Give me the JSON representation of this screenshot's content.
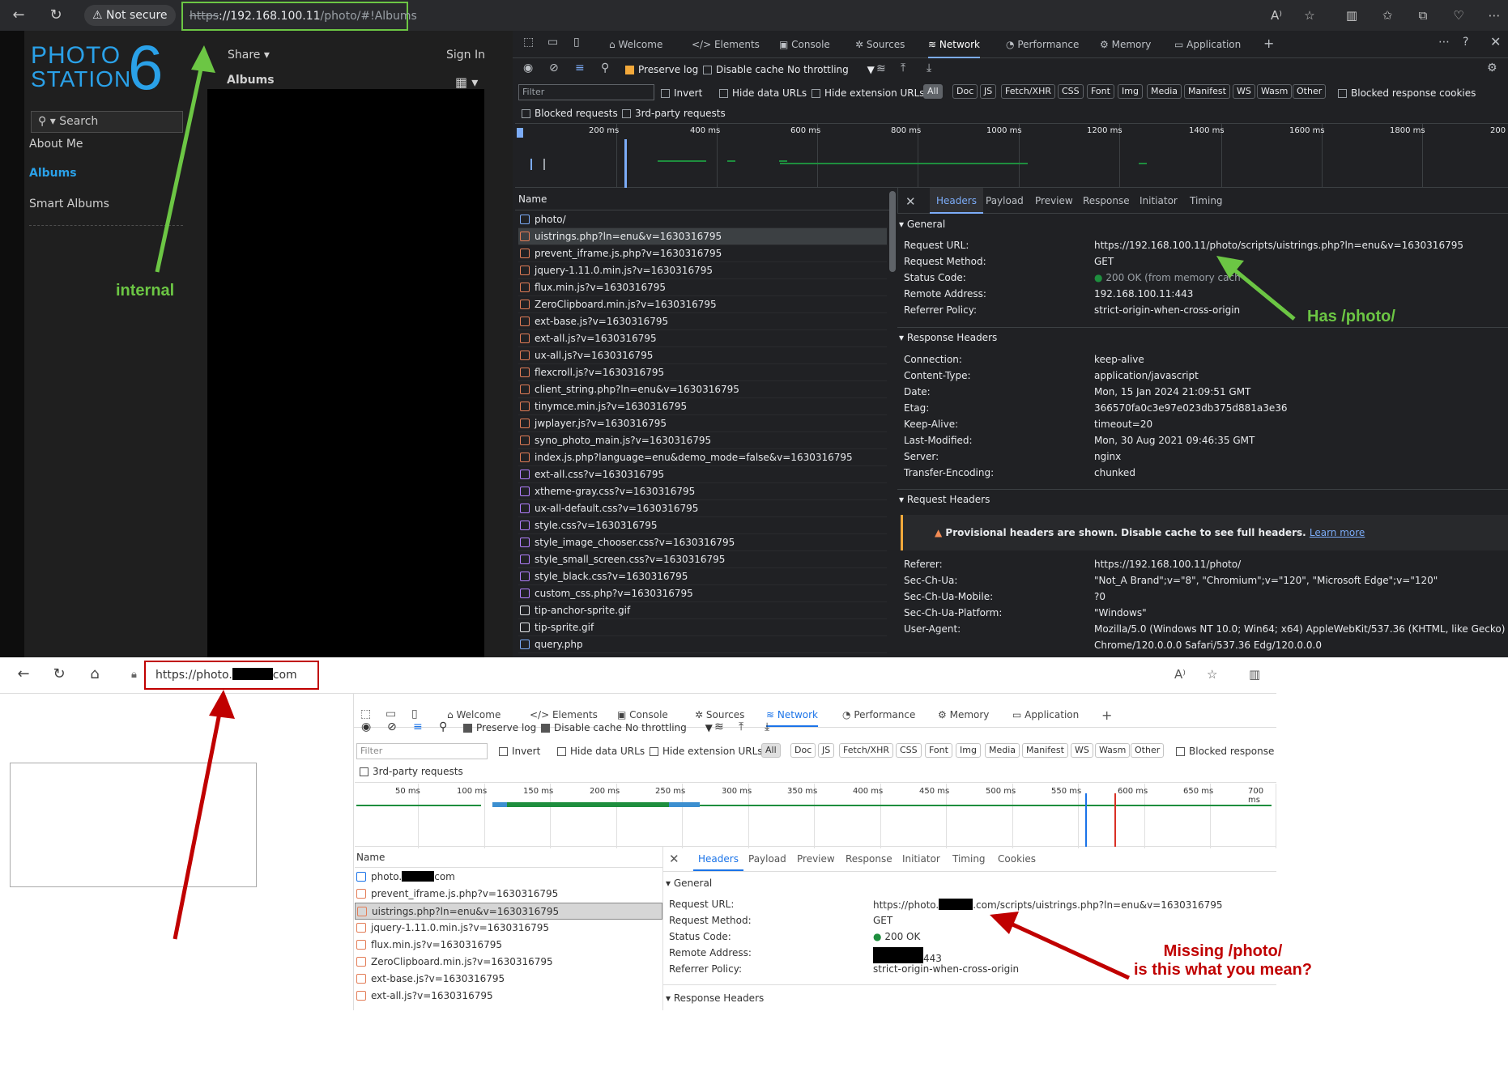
{
  "top": {
    "not_secure": "Not secure",
    "url_https": "https",
    "url_rest": "://192.168.100.11",
    "url_path": "/photo/#!Albums",
    "photostation": {
      "logo_line1": "PHOTO",
      "logo_line2": "STATION",
      "logo_num": "6",
      "share": "Share ▾",
      "sign_in": "Sign In",
      "albums_header": "Albums",
      "search": "Search",
      "nav": [
        "About Me",
        "Albums",
        "Smart Albums"
      ]
    },
    "devtools": {
      "tabs": [
        "Welcome",
        "Elements",
        "Console",
        "Sources",
        "Network",
        "Performance",
        "Memory",
        "Application"
      ],
      "preserve_log": "Preserve log",
      "disable_cache": "Disable cache",
      "throttling": "No throttling",
      "filter_placeholder": "Filter",
      "invert": "Invert",
      "hide_data_urls": "Hide data URLs",
      "hide_ext_urls": "Hide extension URLs",
      "chips": [
        "All",
        "Doc",
        "JS",
        "Fetch/XHR",
        "CSS",
        "Font",
        "Img",
        "Media",
        "Manifest",
        "WS",
        "Wasm",
        "Other"
      ],
      "blocked_cookies": "Blocked response cookies",
      "blocked_requests": "Blocked requests",
      "third_party": "3rd-party requests",
      "ticks": [
        "200 ms",
        "400 ms",
        "600 ms",
        "800 ms",
        "1000 ms",
        "1200 ms",
        "1400 ms",
        "1600 ms",
        "1800 ms",
        "200"
      ],
      "name_header": "Name",
      "requests": [
        "photo/",
        "uistrings.php?ln=enu&v=1630316795",
        "prevent_iframe.js.php?v=1630316795",
        "jquery-1.11.0.min.js?v=1630316795",
        "flux.min.js?v=1630316795",
        "ZeroClipboard.min.js?v=1630316795",
        "ext-base.js?v=1630316795",
        "ext-all.js?v=1630316795",
        "ux-all.js?v=1630316795",
        "flexcroll.js?v=1630316795",
        "client_string.php?ln=enu&v=1630316795",
        "tinymce.min.js?v=1630316795",
        "jwplayer.js?v=1630316795",
        "syno_photo_main.js?v=1630316795",
        "index.js.php?language=enu&demo_mode=false&v=1630316795",
        "ext-all.css?v=1630316795",
        "xtheme-gray.css?v=1630316795",
        "ux-all-default.css?v=1630316795",
        "style.css?v=1630316795",
        "style_image_chooser.css?v=1630316795",
        "style_small_screen.css?v=1630316795",
        "style_black.css?v=1630316795",
        "custom_css.php?v=1630316795",
        "tip-anchor-sprite.gif",
        "tip-sprite.gif",
        "query.php"
      ],
      "detail_tabs": [
        "Headers",
        "Payload",
        "Preview",
        "Response",
        "Initiator",
        "Timing"
      ],
      "general_title": "General",
      "general": [
        [
          "Request URL:",
          "https://192.168.100.11/photo/scripts/uistrings.php?ln=enu&v=1630316795"
        ],
        [
          "Request Method:",
          "GET"
        ],
        [
          "Status Code:",
          "200 OK (from memory cach"
        ],
        [
          "Remote Address:",
          "192.168.100.11:443"
        ],
        [
          "Referrer Policy:",
          "strict-origin-when-cross-origin"
        ]
      ],
      "response_title": "Response Headers",
      "response": [
        [
          "Connection:",
          "keep-alive"
        ],
        [
          "Content-Type:",
          "application/javascript"
        ],
        [
          "Date:",
          "Mon, 15 Jan 2024 21:09:51 GMT"
        ],
        [
          "Etag:",
          "366570fa0c3e97e023db375d881a3e36"
        ],
        [
          "Keep-Alive:",
          "timeout=20"
        ],
        [
          "Last-Modified:",
          "Mon, 30 Aug 2021 09:46:35 GMT"
        ],
        [
          "Server:",
          "nginx"
        ],
        [
          "Transfer-Encoding:",
          "chunked"
        ]
      ],
      "request_title": "Request Headers",
      "provisional": "Provisional headers are shown. Disable cache to see full headers.",
      "learn_more": "Learn more",
      "request": [
        [
          "Referer:",
          "https://192.168.100.11/photo/"
        ],
        [
          "Sec-Ch-Ua:",
          "\"Not_A Brand\";v=\"8\", \"Chromium\";v=\"120\", \"Microsoft Edge\";v=\"120\""
        ],
        [
          "Sec-Ch-Ua-Mobile:",
          "?0"
        ],
        [
          "Sec-Ch-Ua-Platform:",
          "\"Windows\""
        ],
        [
          "User-Agent:",
          "Mozilla/5.0 (Windows NT 10.0; Win64; x64) AppleWebKit/537.36 (KHTML, like Gecko)"
        ]
      ],
      "user_agent_cont": "Chrome/120.0.0.0 Safari/537.36 Edg/120.0.0.0"
    }
  },
  "bottom": {
    "url_prefix": "https://photo.",
    "url_suffix": "com",
    "devtools": {
      "tabs": [
        "Welcome",
        "Elements",
        "Console",
        "Sources",
        "Network",
        "Performance",
        "Memory",
        "Application"
      ],
      "preserve_log": "Preserve log",
      "disable_cache": "Disable cache",
      "throttling": "No throttling",
      "filter_placeholder": "Filter",
      "invert": "Invert",
      "hide_data_urls": "Hide data URLs",
      "hide_ext_urls": "Hide extension URLs",
      "chips": [
        "All",
        "Doc",
        "JS",
        "Fetch/XHR",
        "CSS",
        "Font",
        "Img",
        "Media",
        "Manifest",
        "WS",
        "Wasm",
        "Other"
      ],
      "blocked_cookies": "Blocked response co",
      "third_party": "3rd-party requests",
      "ticks": [
        "50 ms",
        "100 ms",
        "150 ms",
        "200 ms",
        "250 ms",
        "300 ms",
        "350 ms",
        "400 ms",
        "450 ms",
        "500 ms",
        "550 ms",
        "600 ms",
        "650 ms",
        "700 ms"
      ],
      "name_header": "Name",
      "requests": [
        "com",
        "prevent_iframe.js.php?v=1630316795",
        "uistrings.php?ln=enu&v=1630316795",
        "jquery-1.11.0.min.js?v=1630316795",
        "flux.min.js?v=1630316795",
        "ZeroClipboard.min.js?v=1630316795",
        "ext-base.js?v=1630316795",
        "ext-all.js?v=1630316795"
      ],
      "first_req_prefix": "photo.",
      "detail_tabs": [
        "Headers",
        "Payload",
        "Preview",
        "Response",
        "Initiator",
        "Timing",
        "Cookies"
      ],
      "general_title": "General",
      "req_url_prefix": "https://photo.",
      "req_url_suffix": ".com/scripts/uistrings.php?ln=enu&v=1630316795",
      "general_keys": [
        "Request URL:",
        "Request Method:",
        "Status Code:",
        "Remote Address:",
        "Referrer Policy:"
      ],
      "method": "GET",
      "status": "200 OK",
      "remote_suffix": "443",
      "policy": "strict-origin-when-cross-origin",
      "response_title": "Response Headers"
    }
  },
  "annotations": {
    "internal": "internal",
    "has_photo": "Has /photo/",
    "missing_line1": "Missing /photo/",
    "missing_line2": "is this what you mean?"
  },
  "colors": {
    "green_annotation": "#6cc644",
    "red_annotation": "#c00000",
    "photostation_blue": "#2aa1e8",
    "devtools_accent": "#7cacf8"
  }
}
